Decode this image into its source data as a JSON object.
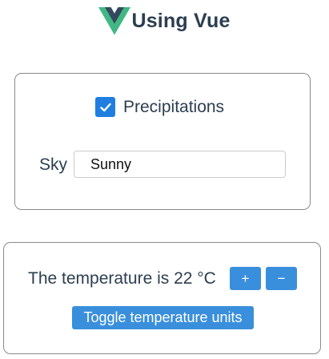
{
  "header": {
    "logo_icon": "vue-logo-icon",
    "title": "Using Vue",
    "colors": {
      "logo_outer": "#41b883",
      "logo_inner": "#35495e",
      "text": "#2c3e50"
    }
  },
  "weather": {
    "precipitations_checked": true,
    "precipitations_label": "Precipitations",
    "sky_label": "Sky",
    "sky_value": "Sunny"
  },
  "temperature": {
    "text": "The temperature is 22 °C",
    "value": 22,
    "unit": "°C",
    "increment_label": "+",
    "decrement_label": "−",
    "toggle_label": "Toggle temperature units",
    "button_color": "#3a8fdc"
  }
}
